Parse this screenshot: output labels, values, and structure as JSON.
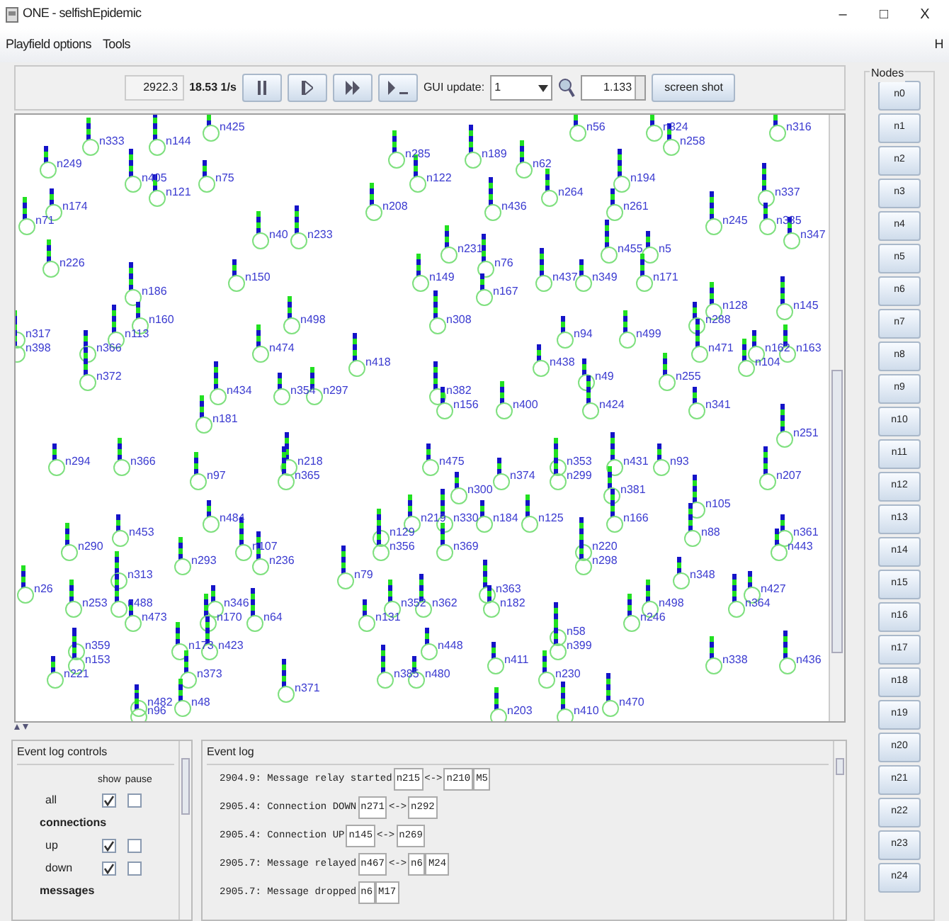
{
  "window": {
    "title": "ONE - selfishEpidemic",
    "controls": [
      "–",
      "□",
      "X"
    ]
  },
  "menu": [
    {
      "label": "Playfield options"
    },
    {
      "label": "Tools"
    },
    {
      "label": "H"
    }
  ],
  "toolbar": {
    "sim_time": "2922.3",
    "rate": "18.53 1/s",
    "gui_update_label": "GUI update:",
    "gui_update_value": "1",
    "zoom_value": "1.133",
    "screenshot_button": "screen shot",
    "buttons": [
      {
        "kind": "pause"
      },
      {
        "kind": "play"
      },
      {
        "kind": "fast"
      },
      {
        "kind": "step"
      }
    ]
  },
  "playfield": {
    "nodes": [
      {
        "label": "n425"
      },
      {
        "label": "n56"
      },
      {
        "label": "n324"
      },
      {
        "label": "n316"
      },
      {
        "label": "n333"
      },
      {
        "label": "n144"
      },
      {
        "label": "n258"
      },
      {
        "label": "n285"
      },
      {
        "label": "n189"
      },
      {
        "label": "n249"
      },
      {
        "label": "n62"
      },
      {
        "label": "n405"
      },
      {
        "label": "n75"
      },
      {
        "label": "n122"
      },
      {
        "label": "n194"
      },
      {
        "label": "n121"
      },
      {
        "label": "n264"
      },
      {
        "label": "n337"
      },
      {
        "label": "n174"
      },
      {
        "label": "n208"
      },
      {
        "label": "n436"
      },
      {
        "label": "n261"
      },
      {
        "label": "n71"
      },
      {
        "label": "n245"
      },
      {
        "label": "n335"
      },
      {
        "label": "n40"
      },
      {
        "label": "n233"
      },
      {
        "label": "n347"
      },
      {
        "label": "n231"
      },
      {
        "label": "n455"
      },
      {
        "label": "n5"
      },
      {
        "label": "n226"
      },
      {
        "label": "n76"
      },
      {
        "label": "n150"
      },
      {
        "label": "n149"
      },
      {
        "label": "n437"
      },
      {
        "label": "n349"
      },
      {
        "label": "n171"
      },
      {
        "label": "n186"
      },
      {
        "label": "n167"
      },
      {
        "label": "n128"
      },
      {
        "label": "n145"
      },
      {
        "label": "n160"
      },
      {
        "label": "n498"
      },
      {
        "label": "n308"
      },
      {
        "label": "n288"
      },
      {
        "label": "n317"
      },
      {
        "label": "n113"
      },
      {
        "label": "n94"
      },
      {
        "label": "n499"
      },
      {
        "label": "n398"
      },
      {
        "label": "n366"
      },
      {
        "label": "n474"
      },
      {
        "label": "n471"
      },
      {
        "label": "n162"
      },
      {
        "label": "n163"
      },
      {
        "label": "n418"
      },
      {
        "label": "n438"
      },
      {
        "label": "n104"
      },
      {
        "label": "n372"
      },
      {
        "label": "n49"
      },
      {
        "label": "n255"
      },
      {
        "label": "n434"
      },
      {
        "label": "n354"
      },
      {
        "label": "n297"
      },
      {
        "label": "n382"
      },
      {
        "label": "n156"
      },
      {
        "label": "n400"
      },
      {
        "label": "n424"
      },
      {
        "label": "n341"
      },
      {
        "label": "n181"
      },
      {
        "label": "n251"
      },
      {
        "label": "n294"
      },
      {
        "label": "n366"
      },
      {
        "label": "n218"
      },
      {
        "label": "n475"
      },
      {
        "label": "n353"
      },
      {
        "label": "n431"
      },
      {
        "label": "n93"
      },
      {
        "label": "n97"
      },
      {
        "label": "n365"
      },
      {
        "label": "n374"
      },
      {
        "label": "n299"
      },
      {
        "label": "n207"
      },
      {
        "label": "n300"
      },
      {
        "label": "n381"
      },
      {
        "label": "n105"
      },
      {
        "label": "n484"
      },
      {
        "label": "n219"
      },
      {
        "label": "n330"
      },
      {
        "label": "n184"
      },
      {
        "label": "n125"
      },
      {
        "label": "n166"
      },
      {
        "label": "n453"
      },
      {
        "label": "n129"
      },
      {
        "label": "n88"
      },
      {
        "label": "n361"
      },
      {
        "label": "n290"
      },
      {
        "label": "n107"
      },
      {
        "label": "n356"
      },
      {
        "label": "n369"
      },
      {
        "label": "n220"
      },
      {
        "label": "n443"
      },
      {
        "label": "n293"
      },
      {
        "label": "n236"
      },
      {
        "label": "n298"
      },
      {
        "label": "n313"
      },
      {
        "label": "n79"
      },
      {
        "label": "n348"
      },
      {
        "label": "n26"
      },
      {
        "label": "n363"
      },
      {
        "label": "n427"
      },
      {
        "label": "n253"
      },
      {
        "label": "n488"
      },
      {
        "label": "n346"
      },
      {
        "label": "n352"
      },
      {
        "label": "n362"
      },
      {
        "label": "n182"
      },
      {
        "label": "n498"
      },
      {
        "label": "n364"
      },
      {
        "label": "n473"
      },
      {
        "label": "n170"
      },
      {
        "label": "n64"
      },
      {
        "label": "n131"
      },
      {
        "label": "n246"
      },
      {
        "label": "n58"
      },
      {
        "label": "n359"
      },
      {
        "label": "n173"
      },
      {
        "label": "n423"
      },
      {
        "label": "n448"
      },
      {
        "label": "n399"
      },
      {
        "label": "n153"
      },
      {
        "label": "n411"
      },
      {
        "label": "n338"
      },
      {
        "label": "n436"
      },
      {
        "label": "n221"
      },
      {
        "label": "n373"
      },
      {
        "label": "n385"
      },
      {
        "label": "n480"
      },
      {
        "label": "n230"
      },
      {
        "label": "n371"
      },
      {
        "label": "n482"
      },
      {
        "label": "n48"
      },
      {
        "label": "n470"
      },
      {
        "label": "n96"
      },
      {
        "label": "n203"
      },
      {
        "label": "n410"
      }
    ]
  },
  "nodes_panel": {
    "title": "Nodes",
    "buttons": [
      {
        "label": "n0"
      },
      {
        "label": "n1"
      },
      {
        "label": "n2"
      },
      {
        "label": "n3"
      },
      {
        "label": "n4"
      },
      {
        "label": "n5"
      },
      {
        "label": "n6"
      },
      {
        "label": "n7"
      },
      {
        "label": "n8"
      },
      {
        "label": "n9"
      },
      {
        "label": "n10"
      },
      {
        "label": "n11"
      },
      {
        "label": "n12"
      },
      {
        "label": "n13"
      },
      {
        "label": "n14"
      },
      {
        "label": "n15"
      },
      {
        "label": "n16"
      },
      {
        "label": "n17"
      },
      {
        "label": "n18"
      },
      {
        "label": "n19"
      },
      {
        "label": "n20"
      },
      {
        "label": "n21"
      },
      {
        "label": "n22"
      },
      {
        "label": "n23"
      },
      {
        "label": "n24"
      }
    ]
  },
  "event_log_controls": {
    "title": "Event log controls",
    "columns": [
      "show",
      "pause"
    ],
    "rows": [
      {
        "kind": "option",
        "label": "all",
        "show": true,
        "pause": false
      },
      {
        "kind": "heading",
        "label": "connections"
      },
      {
        "kind": "option",
        "label": "up",
        "show": true,
        "pause": false
      },
      {
        "kind": "option",
        "label": "down",
        "show": true,
        "pause": false
      },
      {
        "kind": "heading",
        "label": "messages"
      }
    ]
  },
  "event_log": {
    "title": "Event log",
    "entries": [
      {
        "parts": [
          {
            "kind": "text",
            "text": "2904.9: Message relay started"
          },
          {
            "kind": "link",
            "text": "n215"
          },
          {
            "kind": "text",
            "text": "<->"
          },
          {
            "kind": "link",
            "text": "n210"
          },
          {
            "kind": "link",
            "text": "M5"
          }
        ]
      },
      {
        "parts": [
          {
            "kind": "text",
            "text": "2905.4: Connection DOWN"
          },
          {
            "kind": "link",
            "text": "n271"
          },
          {
            "kind": "text",
            "text": "<->"
          },
          {
            "kind": "link",
            "text": "n292"
          }
        ]
      },
      {
        "parts": [
          {
            "kind": "text",
            "text": "2905.4: Connection UP"
          },
          {
            "kind": "link",
            "text": "n145"
          },
          {
            "kind": "text",
            "text": "<->"
          },
          {
            "kind": "link",
            "text": "n269"
          }
        ]
      },
      {
        "parts": [
          {
            "kind": "text",
            "text": "2905.7: Message relayed"
          },
          {
            "kind": "link",
            "text": "n467"
          },
          {
            "kind": "text",
            "text": "<->"
          },
          {
            "kind": "link",
            "text": "n6"
          },
          {
            "kind": "link",
            "text": "M24"
          }
        ]
      },
      {
        "parts": [
          {
            "kind": "text",
            "text": "2905.7: Message dropped"
          },
          {
            "kind": "link",
            "text": "n6"
          },
          {
            "kind": "link",
            "text": "M17"
          }
        ]
      }
    ]
  }
}
